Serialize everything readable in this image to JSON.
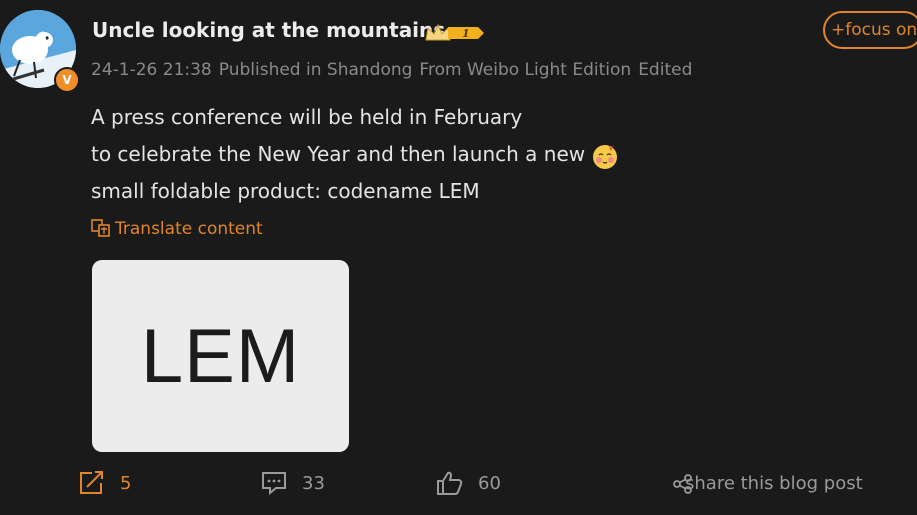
{
  "post": {
    "author": "Uncle looking at the mountains",
    "verified_badge": "V",
    "crown_badge_level": "1",
    "date": "24-1-26 21:38",
    "location": "Published in Shandong",
    "source": "From Weibo Light Edition",
    "edited": "Edited",
    "follow_label": "+focus on",
    "content_lines": [
      "A press conference will be held in February",
      "to celebrate the New Year and then launch a new",
      "small foldable product: codename LEM"
    ],
    "translate_label": "Translate content",
    "image_text": "LEM"
  },
  "actions": {
    "repost_count": "5",
    "comment_count": "33",
    "like_count": "60",
    "share_label": "share this blog post"
  },
  "icons": {
    "avatar": "dog-avatar-icon",
    "crown": "crown-icon",
    "emoji": "shy-face-emoji-icon",
    "translate": "translate-icon",
    "repost": "repost-icon",
    "comment": "comment-icon",
    "like": "thumbs-up-icon",
    "share": "share-icon"
  },
  "colors": {
    "background": "#1a1a1a",
    "accent": "#e0852a",
    "muted": "#8a8a8a",
    "text": "#e4e4e4"
  }
}
